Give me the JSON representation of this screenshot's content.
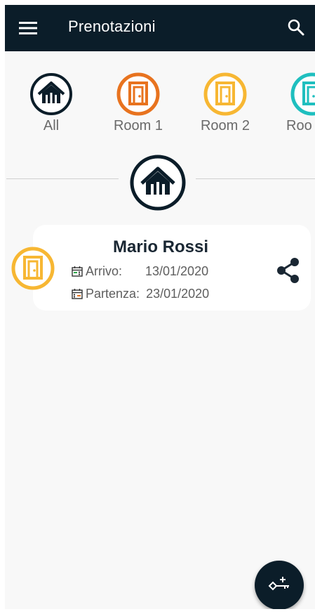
{
  "appbar": {
    "title": "Prenotazioni",
    "menu_icon": "hamburger-menu-icon",
    "search_icon": "search-icon"
  },
  "filters": [
    {
      "label": "All",
      "icon": "house-icon",
      "color": "#0b1d29"
    },
    {
      "label": "Room 1",
      "icon": "door-icon",
      "color": "#e8731f"
    },
    {
      "label": "Room 2",
      "icon": "door-icon",
      "color": "#f7b733"
    },
    {
      "label": "Roo",
      "icon": "door-icon",
      "color": "#1fbfbf"
    }
  ],
  "selected_filter": {
    "icon": "house-icon",
    "color": "#0b1d29"
  },
  "reservations": [
    {
      "guest": "Mario Rossi",
      "room_icon": "door-icon",
      "room_color": "#f7b733",
      "arrival_label": "Arrivo:",
      "arrival_date": "13/01/2020",
      "departure_label": "Partenza:",
      "departure_date": "23/01/2020",
      "action_icon": "share-icon"
    }
  ],
  "fab": {
    "icon": "add-key-icon"
  },
  "colors": {
    "primary": "#0b1d29",
    "background": "#f8f8f8"
  }
}
